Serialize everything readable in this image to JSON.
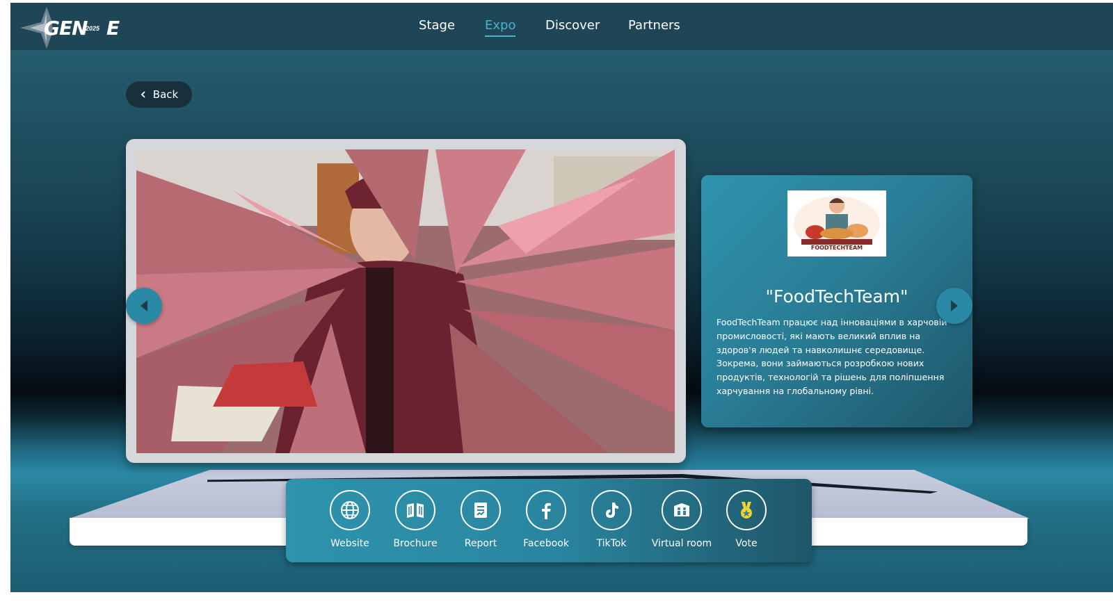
{
  "logo": {
    "text": "GEN",
    "year": "2025",
    "suffix": "E"
  },
  "nav": {
    "items": [
      {
        "label": "Stage",
        "active": false
      },
      {
        "label": "Expo",
        "active": true
      },
      {
        "label": "Discover",
        "active": false
      },
      {
        "label": "Partners",
        "active": false
      }
    ]
  },
  "back": {
    "label": "Back",
    "icon": "chevron-left-icon"
  },
  "video": {
    "prev_icon": "triangle-left-icon",
    "next_icon": "triangle-right-icon"
  },
  "team": {
    "logo_text": "FOODTECHTEAM",
    "title": "\"FoodTechTeam\"",
    "description": "FoodTechTeam працює над інноваціями в харчовій промисловості, які мають великий вплив на здоров'я людей та навколишнє середовище. Зокрема, вони займаються розробкою нових продуктів, технологій та рішень для поліпшення харчування на глобальному рівні."
  },
  "actions": [
    {
      "label": "Website",
      "icon": "globe-icon"
    },
    {
      "label": "Brochure",
      "icon": "book-icon"
    },
    {
      "label": "Report",
      "icon": "report-icon"
    },
    {
      "label": "Facebook",
      "icon": "facebook-icon"
    },
    {
      "label": "TikTok",
      "icon": "tiktok-icon"
    },
    {
      "label": "Virtual room",
      "icon": "virtual-room-icon"
    },
    {
      "label": "Vote",
      "icon": "medal-icon"
    }
  ],
  "colors": {
    "topbar": "#1f4656",
    "accent": "#4bb3cd",
    "card": "#2f93ad",
    "medal": "#f2d22e"
  }
}
